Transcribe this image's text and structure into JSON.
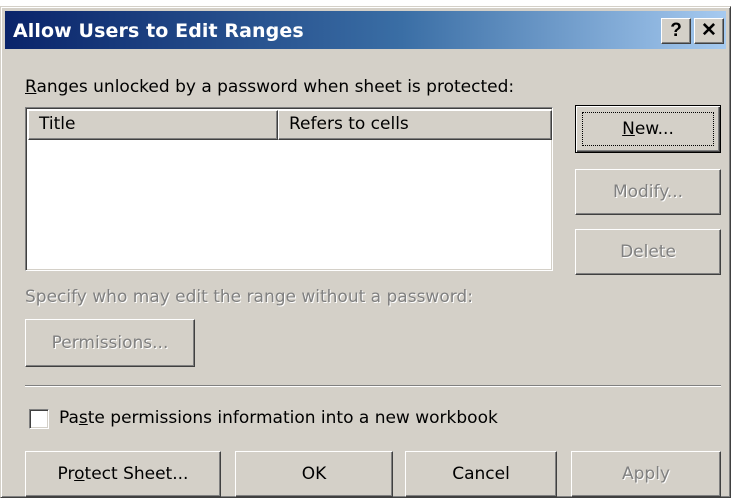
{
  "window": {
    "title": "Allow Users to Edit Ranges",
    "help_label": "?",
    "close_label": "✕"
  },
  "ranges": {
    "label_accel": "R",
    "label_rest": "anges unlocked by a password when sheet is protected:",
    "columns": [
      "Title",
      "Refers to cells"
    ],
    "rows": []
  },
  "buttons": {
    "new_accel": "N",
    "new_rest": "ew...",
    "modify": "Modify...",
    "delete": "Delete",
    "permissions": "Permissions...",
    "protect_pre": "Pr",
    "protect_accel": "o",
    "protect_rest": "tect Sheet...",
    "ok": "OK",
    "cancel": "Cancel",
    "apply": "Apply"
  },
  "permissions_label": "Specify who may edit the range without a password:",
  "paste_checkbox": {
    "checked": false,
    "label_pre": "Pa",
    "label_accel": "s",
    "label_rest": "te permissions information into a new workbook"
  },
  "colors": {
    "dialog_bg": "#d4d0c8",
    "title_gradient_start": "#0a246a",
    "title_gradient_end": "#a6caf0",
    "disabled_text": "#808080"
  }
}
